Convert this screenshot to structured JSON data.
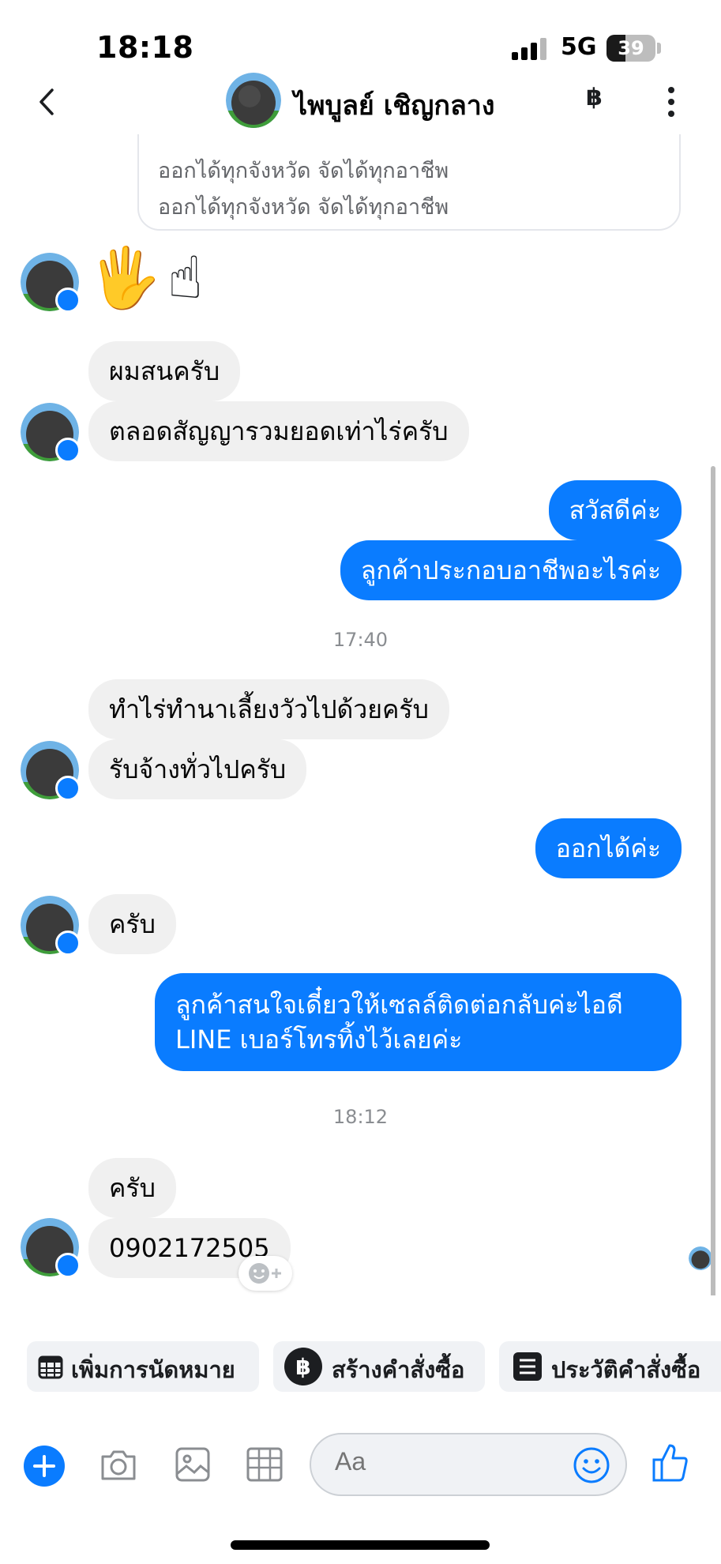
{
  "status_bar": {
    "time": "18:18",
    "network": "5G",
    "battery": "39",
    "battery_level": 0.39
  },
  "header": {
    "contact_name": "ไพบูลย์ เชิญกลาง",
    "baht_icon_label": "฿"
  },
  "quote": {
    "lines": [
      "ออกได้ทุกจังหวัด จัดได้ทุกอาชีพ",
      "ออกได้ทุกจังหวัด จัดได้ทุกอาชีพ"
    ]
  },
  "messages": {
    "emoji_1": "🖐",
    "emoji_2": "☝",
    "in_1": "ผมสนครับ",
    "in_2": "ตลอดสัญญารวมยอดเท่าไร่ครับ",
    "out_1": "สวัสดีค่ะ",
    "out_2": "ลูกค้าประกอบอาชีพอะไรค่ะ",
    "time_1": "17:40",
    "in_3": "ทำไร่ทำนาเลี้ยงวัวไปด้วยครับ",
    "in_4": "รับจ้างทั่วไปครับ",
    "out_3": "ออกได้ค่ะ",
    "in_5": "ครับ",
    "out_4": "ลูกค้าสนใจเดี๋ยวให้เซลล์ติดต่อกลับค่ะไอดี LINE เบอร์โทรทิ้งไว้เลยค่ะ",
    "time_2": "18:12",
    "in_6": "ครับ",
    "in_7": "0902172505"
  },
  "quick_actions": {
    "appointment": "เพิ่มการนัดหมาย",
    "create_order": "สร้างคำสั่งซื้อ",
    "order_history": "ประวัติคำสั่งซื้อ"
  },
  "composer": {
    "placeholder": "Aa"
  },
  "colors": {
    "accent": "#0a7cff",
    "incoming_bubble": "#f0f0f0"
  }
}
